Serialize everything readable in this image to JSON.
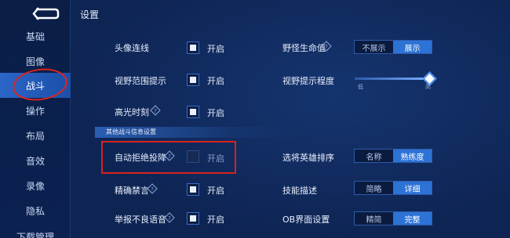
{
  "page_title": "设置",
  "sidebar": {
    "items": [
      {
        "label": "基础",
        "active": false
      },
      {
        "label": "图像",
        "active": false
      },
      {
        "label": "战斗",
        "active": true
      },
      {
        "label": "操作",
        "active": false
      },
      {
        "label": "布局",
        "active": false
      },
      {
        "label": "音效",
        "active": false
      },
      {
        "label": "录像",
        "active": false
      },
      {
        "label": "隐私",
        "active": false
      },
      {
        "label": "下载管理",
        "active": false
      }
    ]
  },
  "left_settings": [
    {
      "label": "头像连线",
      "checked": true,
      "state_label": "开启",
      "help": false
    },
    {
      "label": "视野范围提示",
      "checked": true,
      "state_label": "开启",
      "help": false
    },
    {
      "label": "高光时刻",
      "checked": true,
      "state_label": "开启",
      "help": true
    }
  ],
  "section_title": "其他战斗信息设置",
  "left_settings_2": [
    {
      "label": "自动拒绝投降",
      "checked": false,
      "state_label": "开启",
      "help": true
    },
    {
      "label": "精确禁言",
      "checked": true,
      "state_label": "开启",
      "help": true
    },
    {
      "label": "举报不良语音",
      "checked": true,
      "state_label": "开启",
      "help": true
    }
  ],
  "right_settings": {
    "monster_hp": {
      "label": "野怪生命值",
      "options": [
        "不展示",
        "展示"
      ],
      "selected": 1
    },
    "vision_level": {
      "label": "视野提示程度",
      "low": "低",
      "high": "高",
      "level_fraction": 1.0
    },
    "hero_sort": {
      "label": "选将英雄排序",
      "options": [
        "名称",
        "熟练度"
      ],
      "selected": 1
    },
    "skill_desc": {
      "label": "技能描述",
      "options": [
        "简略",
        "详细"
      ],
      "selected": 1
    },
    "ob_ui": {
      "label": "OB界面设置",
      "options": [
        "精简",
        "完整"
      ],
      "selected": 1
    }
  },
  "colors": {
    "background": "#0e2554",
    "accent": "#2d73d6",
    "annotation_red": "#e2231a"
  }
}
